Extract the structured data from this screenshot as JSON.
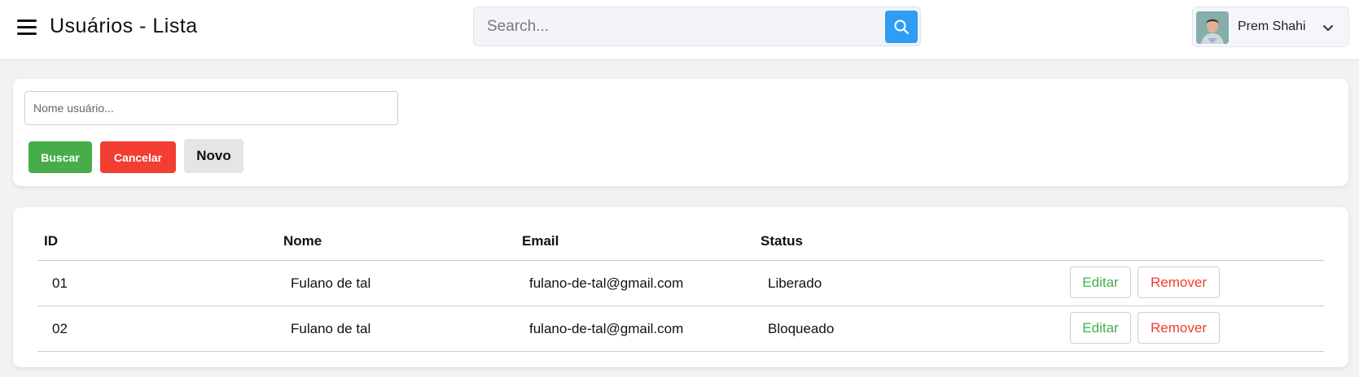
{
  "header": {
    "title": "Usuários - Lista",
    "search_placeholder": "Search...",
    "user_name": "Prem Shahi"
  },
  "filter": {
    "name_placeholder": "Nome usuário...",
    "buscar_label": "Buscar",
    "cancelar_label": "Cancelar",
    "novo_label": "Novo"
  },
  "table": {
    "columns": [
      "ID",
      "Nome",
      "Email",
      "Status"
    ],
    "rows": [
      {
        "id": "01",
        "nome": "Fulano de tal",
        "email": "fulano-de-tal@gmail.com",
        "status": "Liberado",
        "edit_label": "Editar",
        "remove_label": "Remover"
      },
      {
        "id": "02",
        "nome": "Fulano de tal",
        "email": "fulano-de-tal@gmail.com",
        "status": "Bloqueado",
        "edit_label": "Editar",
        "remove_label": "Remover"
      }
    ]
  },
  "colors": {
    "accent_blue": "#2f9df4",
    "success_green": "#46ad4a",
    "danger_red": "#f23d32"
  },
  "icons": [
    "menu-icon",
    "search-icon",
    "chevron-down-icon"
  ]
}
